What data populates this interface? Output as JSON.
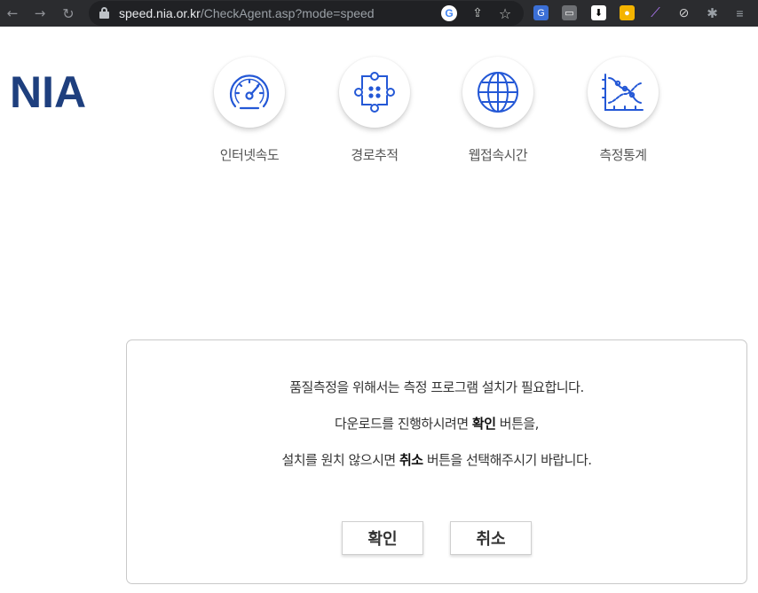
{
  "browser": {
    "url_host": "speed.nia.or.kr",
    "url_path": "/CheckAgent.asp?mode=speed",
    "icons": [
      "back-icon",
      "forward-icon",
      "reload-icon",
      "lock-icon",
      "google-translate-icon",
      "share-icon",
      "bookmark-star-icon",
      "extension-icons",
      "puzzle-icon",
      "reading-list-icon"
    ]
  },
  "header": {
    "logo": "NIA",
    "logo_color": "#1e3f7e",
    "menu": [
      {
        "label": "인터넷속도",
        "icon": "speedometer-icon"
      },
      {
        "label": "경로추적",
        "icon": "route-trace-icon"
      },
      {
        "label": "웹접속시간",
        "icon": "globe-icon"
      },
      {
        "label": "측정통계",
        "icon": "statistics-chart-icon"
      }
    ],
    "icon_color": "#2458d6"
  },
  "dialog": {
    "line1": "품질측정을 위해서는 측정 프로그램 설치가 필요합니다.",
    "line2_before": "다운로드를 진행하시려면 ",
    "line2_bold": "확인",
    "line2_after": " 버튼을,",
    "line3_before": "설치를 원치 않으시면 ",
    "line3_bold": "취소",
    "line3_after": " 버튼을 선택해주시기 바랍니다.",
    "ok_label": "확인",
    "cancel_label": "취소"
  }
}
